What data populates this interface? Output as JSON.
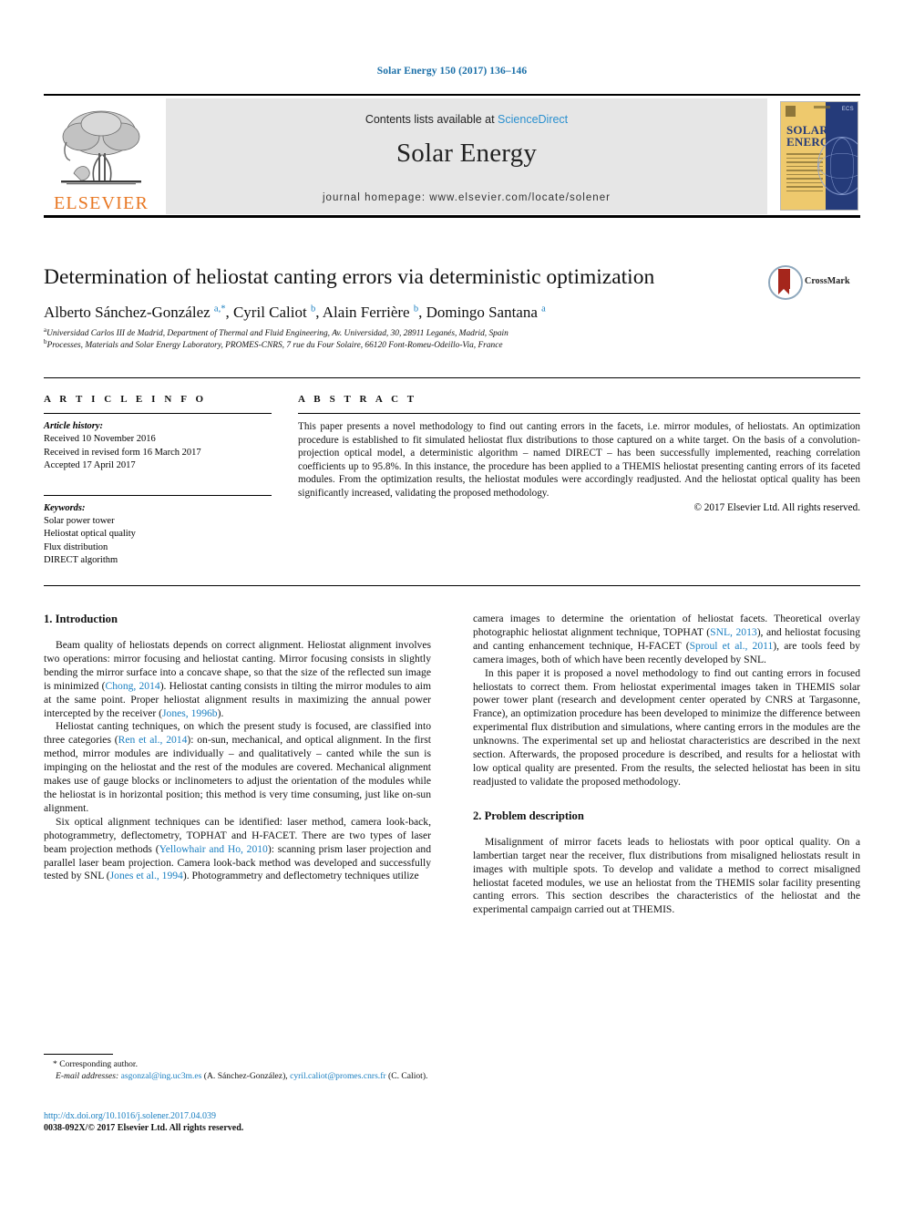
{
  "running_head": "Solar Energy 150 (2017) 136–146",
  "masthead": {
    "publisher_name": "ELSEVIER",
    "contents_prefix": "Contents lists available at ",
    "contents_link": "ScienceDirect",
    "journal_title": "Solar Energy",
    "homepage_line": "journal homepage: www.elsevier.com/locate/solener",
    "cover_title_line1": "SOLAR",
    "cover_title_line2": "ENERGY",
    "cover_badge": "ECS"
  },
  "article": {
    "title": "Determination of heliostat canting errors via deterministic optimization",
    "crossmark_label": "CrossMark",
    "authors_html": "Alberto Sánchez-González <sup>a,*</sup>, Cyril Caliot <sup>b</sup>, Alain Ferrière <sup>b</sup>, Domingo Santana <sup>a</sup>",
    "affiliation_a": "Universidad Carlos III de Madrid, Department of Thermal and Fluid Engineering, Av. Universidad, 30, 28911 Leganés, Madrid, Spain",
    "affiliation_b": "Processes, Materials and Solar Energy Laboratory, PROMES-CNRS, 7 rue du Four Solaire, 66120 Font-Romeu-Odeillo-Via, France"
  },
  "info": {
    "heading": "A R T I C L E   I N F O",
    "history_label": "Article history:",
    "history": [
      "Received 10 November 2016",
      "Received in revised form 16 March 2017",
      "Accepted 17 April 2017"
    ],
    "keywords_label": "Keywords:",
    "keywords": [
      "Solar power tower",
      "Heliostat optical quality",
      "Flux distribution",
      "DIRECT algorithm"
    ]
  },
  "abstract": {
    "heading": "A B S T R A C T",
    "text": "This paper presents a novel methodology to find out canting errors in the facets, i.e. mirror modules, of heliostats. An optimization procedure is established to fit simulated heliostat flux distributions to those captured on a white target. On the basis of a convolution-projection optical model, a deterministic algorithm – named DIRECT – has been successfully implemented, reaching correlation coefficients up to 95.8%. In this instance, the procedure has been applied to a THEMIS heliostat presenting canting errors of its faceted modules. From the optimization results, the heliostat modules were accordingly readjusted. And the heliostat optical quality has been significantly increased, validating the proposed methodology.",
    "copyright": "© 2017 Elsevier Ltd. All rights reserved."
  },
  "sections": {
    "introduction_heading": "1. Introduction",
    "intro_p1_html": "Beam quality of heliostats depends on correct alignment. Heliostat alignment involves two operations: mirror focusing and heliostat canting. Mirror focusing consists in slightly bending the mirror surface into a concave shape, so that the size of the reflected sun image is minimized (<a class=\"ref\" data-name=\"citation-link\" data-interactable=\"true\">Chong, 2014</a>). Heliostat canting consists in tilting the mirror modules to aim at the same point. Proper heliostat alignment results in maximizing the annual power intercepted by the receiver (<a class=\"ref\" data-name=\"citation-link\" data-interactable=\"true\">Jones, 1996b</a>).",
    "intro_p2_html": "Heliostat canting techniques, on which the present study is focused, are classified into three categories (<a class=\"ref\" data-name=\"citation-link\" data-interactable=\"true\">Ren et al., 2014</a>): on-sun, mechanical, and optical alignment. In the first method, mirror modules are individually – and qualitatively – canted while the sun is impinging on the heliostat and the rest of the modules are covered. Mechanical alignment makes use of gauge blocks or inclinometers to adjust the orientation of the modules while the heliostat is in horizontal position; this method is very time consuming, just like on-sun alignment.",
    "intro_p3_html": "Six optical alignment techniques can be identified: laser method, camera look-back, photogrammetry, deflectometry, TOPHAT and H-FACET. There are two types of laser beam projection methods (<a class=\"ref\" data-name=\"citation-link\" data-interactable=\"true\">Yellowhair and Ho, 2010</a>): scanning prism laser projection and parallel laser beam projection. Camera look-back method was developed and successfully tested by SNL (<a class=\"ref\" data-name=\"citation-link\" data-interactable=\"true\">Jones et al., 1994</a>). Photogrammetry and deflectometry techniques utilize",
    "intro_p4_html": "camera images to determine the orientation of heliostat facets. Theoretical overlay photographic heliostat alignment technique, TOPHAT (<a class=\"ref\" data-name=\"citation-link\" data-interactable=\"true\">SNL, 2013</a>), and heliostat focusing and canting enhancement technique, H-FACET (<a class=\"ref\" data-name=\"citation-link\" data-interactable=\"true\">Sproul et al., 2011</a>), are tools feed by camera images, both of which have been recently developed by SNL.",
    "intro_p5_html": "In this paper it is proposed a novel methodology to find out canting errors in focused heliostats to correct them. From heliostat experimental images taken in THEMIS solar power tower plant (research and development center operated by CNRS at Targasonne, France), an optimization procedure has been developed to minimize the difference between experimental flux distribution and simulations, where canting errors in the modules are the unknowns. The experimental set up and heliostat characteristics are described in the next section. Afterwards, the proposed procedure is described, and results for a heliostat with low optical quality are presented. From the results, the selected heliostat has been in situ readjusted to validate the proposed methodology.",
    "problem_heading": "2. Problem description",
    "problem_p1_html": "Misalignment of mirror facets leads to heliostats with poor optical quality. On a lambertian target near the receiver, flux distributions from misaligned heliostats result in images with multiple spots. To develop and validate a method to correct misaligned heliostat faceted modules, we use an heliostat from the THEMIS solar facility presenting canting errors. This section describes the characteristics of the heliostat and the experimental campaign carried out at THEMIS."
  },
  "footnote": {
    "corresponding": "* Corresponding author.",
    "email_html": "<i>E-mail addresses:</i> <a class=\"ref\" data-name=\"email-link\" data-interactable=\"true\">asgonzal@ing.uc3m.es</a> (A. Sánchez-González), <a class=\"ref\" data-name=\"email-link\" data-interactable=\"true\">cyril.caliot@promes.cnrs.fr</a> (C. Caliot).",
    "doi": "http://dx.doi.org/10.1016/j.solener.2017.04.039",
    "issn_line": "0038-092X/© 2017 Elsevier Ltd. All rights reserved."
  },
  "colors": {
    "link_blue": "#1a7fc1",
    "header_blue": "#1a6fa8",
    "elsevier_orange": "#e87722",
    "band_gray": "#e6e6e6"
  }
}
